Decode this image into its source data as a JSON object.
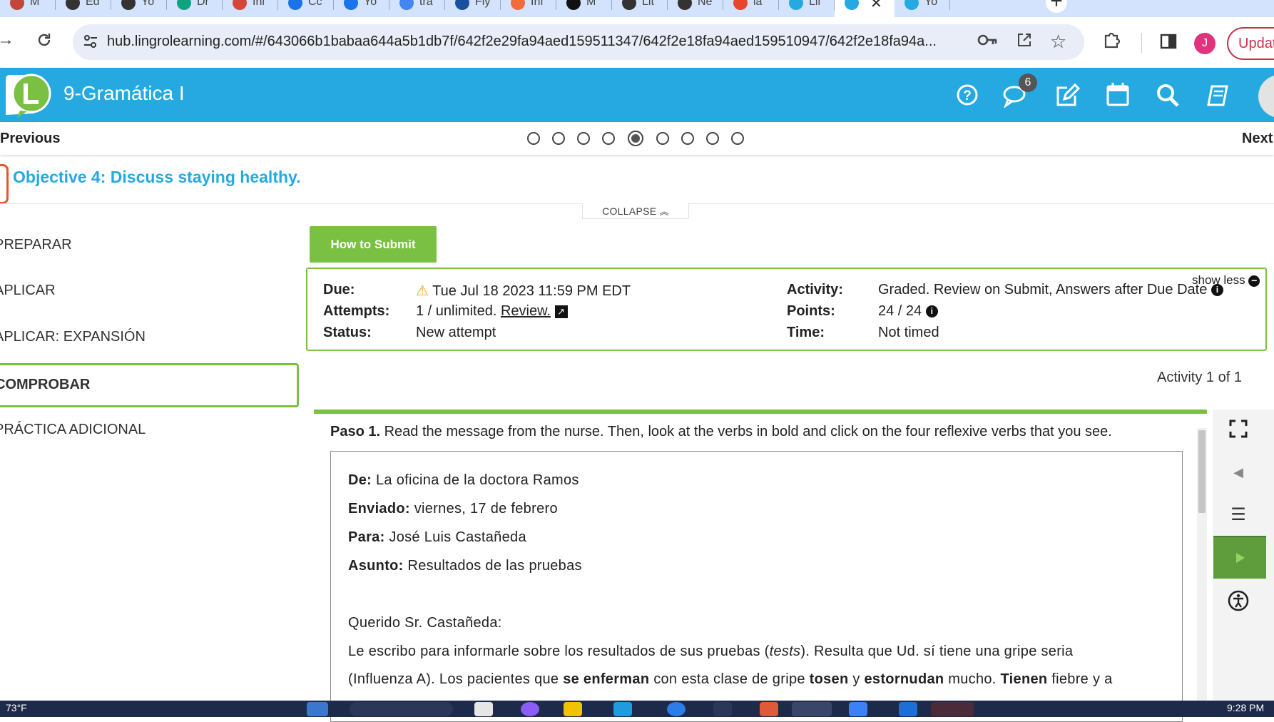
{
  "browser": {
    "tabs": [
      {
        "label": "M",
        "color": "#c4463a"
      },
      {
        "label": "Ed",
        "color": "#333333"
      },
      {
        "label": "Yo",
        "color": "#333333"
      },
      {
        "label": "Dr",
        "color": "#10a37f"
      },
      {
        "label": "Inl",
        "color": "#d44638"
      },
      {
        "label": "Cc",
        "color": "#1a73e8"
      },
      {
        "label": "Yo",
        "color": "#1a73e8"
      },
      {
        "label": "tra",
        "color": "#4285f4"
      },
      {
        "label": "Fly",
        "color": "#1a4fa0"
      },
      {
        "label": "Inf",
        "color": "#f26b3a"
      },
      {
        "label": "M",
        "color": "#111111"
      },
      {
        "label": "Lit",
        "color": "#333333"
      },
      {
        "label": "Ne",
        "color": "#333333"
      },
      {
        "label": "la",
        "color": "#e8462a"
      },
      {
        "label": "Lii",
        "color": "#25a9e0"
      },
      {
        "label": "",
        "color": "#25a9e0"
      },
      {
        "label": "Yo",
        "color": "#25a9e0"
      }
    ],
    "active_tab_close": "✕",
    "new_tab": "+",
    "url": "hub.lingrolearning.com/#/643066b1babaa644a5b1db7f/642f2e29fa94aed159511347/642f2e18fa94aed159510947/642f2e18fa94a...",
    "profile_initial": "J",
    "update_label": "Updat"
  },
  "header": {
    "course_title": "9-Gramática I",
    "messages_badge": "6"
  },
  "nav": {
    "previous": "Previous",
    "next": "Next",
    "dots_total": 9,
    "active_dot": 5
  },
  "objective": {
    "title": "Objective 4: Discuss staying healthy.",
    "collapse_label": "COLLAPSE"
  },
  "sidebar": {
    "items": [
      "PREPARAR",
      "APLICAR",
      "APLICAR: EXPANSIÓN",
      "COMPROBAR",
      "PRÁCTICA ADICIONAL"
    ],
    "active": 3
  },
  "submit": {
    "how_to_submit": "How to Submit"
  },
  "info": {
    "due_label": "Due:",
    "due_value": "Tue Jul 18 2023 11:59 PM EDT",
    "attempts_label": "Attempts:",
    "attempts_value": "1 / unlimited.",
    "review_link": "Review.",
    "status_label": "Status:",
    "status_value": "New attempt",
    "activity_label": "Activity:",
    "activity_value": "Graded. Review on Submit, Answers after Due Date",
    "points_label": "Points:",
    "points_value": "24 / 24",
    "time_label": "Time:",
    "time_value": "Not timed",
    "show_less": "show less"
  },
  "activity_count": "Activity 1 of 1",
  "exercise": {
    "paso_label": "Paso 1.",
    "paso_text": " Read the message from the nurse. Then, look at the verbs in bold and click on the four reflexive verbs that you see.",
    "de_label": "De:",
    "de_value": " La oficina de la doctora Ramos",
    "enviado_label": "Enviado:",
    "enviado_value": " viernes, 17 de febrero",
    "para_label": "Para:",
    "para_value": " José Luis Castañeda",
    "asunto_label": "Asunto:",
    "asunto_value": " Resultados de las pruebas",
    "greeting": "Querido Sr. Castañeda:",
    "p1_a": "Le escribo para informarle sobre los resultados de sus pruebas (",
    "p1_tests": "tests",
    "p1_b": "). Resulta que Ud. sí tiene una gripe seria",
    "p2_a": "(Influenza A). Los pacientes que ",
    "p2_v1": "se enferman",
    "p2_b": " con esta clase de gripe ",
    "p2_v2": "tosen",
    "p2_c": " y ",
    "p2_v3": "estornudan",
    "p2_d": " mucho. ",
    "p2_v4": "Tienen",
    "p2_e": " fiebre y a"
  },
  "taskbar": {
    "weather": "73°F",
    "clock": "9:28 PM"
  },
  "colors": {
    "brand_blue": "#25a9e0",
    "accent_green": "#7ac043",
    "play_green": "#5e9c3c"
  }
}
